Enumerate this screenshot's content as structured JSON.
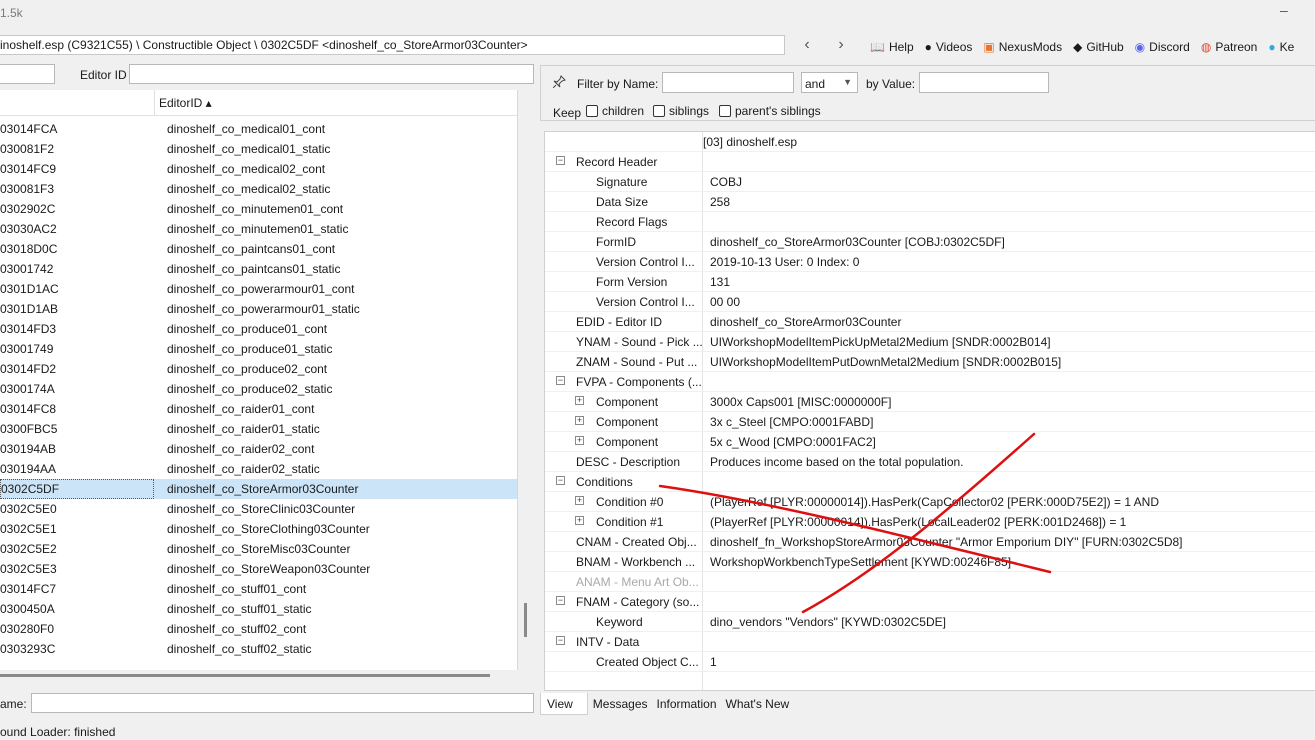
{
  "window": {
    "title": "1.5k",
    "minimize": "–"
  },
  "path": "inoshelf.esp (C9321C55) \\ Constructible Object \\ 0302C5DF <dinoshelf_co_StoreArmor03Counter>",
  "nav": {
    "back": "‹",
    "forward": "›"
  },
  "links": [
    {
      "icon": "📖",
      "label": "Help"
    },
    {
      "icon": "●",
      "label": "Videos"
    },
    {
      "icon": "▣",
      "label": "NexusMods"
    },
    {
      "icon": "◆",
      "label": "GitHub"
    },
    {
      "icon": "◉",
      "label": "Discord"
    },
    {
      "icon": "◍",
      "label": "Patreon"
    },
    {
      "icon": "●",
      "label": "Ke"
    }
  ],
  "left": {
    "editor_id_label": "Editor ID",
    "column_header": "EditorID ▴",
    "rows": [
      {
        "formid": "03014FCA",
        "edid": "dinoshelf_co_medical01_cont"
      },
      {
        "formid": "030081F2",
        "edid": "dinoshelf_co_medical01_static"
      },
      {
        "formid": "03014FC9",
        "edid": "dinoshelf_co_medical02_cont"
      },
      {
        "formid": "030081F3",
        "edid": "dinoshelf_co_medical02_static"
      },
      {
        "formid": "0302902C",
        "edid": "dinoshelf_co_minutemen01_cont"
      },
      {
        "formid": "03030AC2",
        "edid": "dinoshelf_co_minutemen01_static"
      },
      {
        "formid": "03018D0C",
        "edid": "dinoshelf_co_paintcans01_cont"
      },
      {
        "formid": "03001742",
        "edid": "dinoshelf_co_paintcans01_static"
      },
      {
        "formid": "0301D1AC",
        "edid": "dinoshelf_co_powerarmour01_cont"
      },
      {
        "formid": "0301D1AB",
        "edid": "dinoshelf_co_powerarmour01_static"
      },
      {
        "formid": "03014FD3",
        "edid": "dinoshelf_co_produce01_cont"
      },
      {
        "formid": "03001749",
        "edid": "dinoshelf_co_produce01_static"
      },
      {
        "formid": "03014FD2",
        "edid": "dinoshelf_co_produce02_cont"
      },
      {
        "formid": "0300174A",
        "edid": "dinoshelf_co_produce02_static"
      },
      {
        "formid": "03014FC8",
        "edid": "dinoshelf_co_raider01_cont"
      },
      {
        "formid": "0300FBC5",
        "edid": "dinoshelf_co_raider01_static"
      },
      {
        "formid": "030194AB",
        "edid": "dinoshelf_co_raider02_cont"
      },
      {
        "formid": "030194AA",
        "edid": "dinoshelf_co_raider02_static"
      },
      {
        "formid": "0302C5DF",
        "edid": "dinoshelf_co_StoreArmor03Counter"
      },
      {
        "formid": "0302C5E0",
        "edid": "dinoshelf_co_StoreClinic03Counter"
      },
      {
        "formid": "0302C5E1",
        "edid": "dinoshelf_co_StoreClothing03Counter"
      },
      {
        "formid": "0302C5E2",
        "edid": "dinoshelf_co_StoreMisc03Counter"
      },
      {
        "formid": "0302C5E3",
        "edid": "dinoshelf_co_StoreWeapon03Counter"
      },
      {
        "formid": "03014FC7",
        "edid": "dinoshelf_co_stuff01_cont"
      },
      {
        "formid": "0300450A",
        "edid": "dinoshelf_co_stuff01_static"
      },
      {
        "formid": "030280F0",
        "edid": "dinoshelf_co_stuff02_cont"
      },
      {
        "formid": "0303293C",
        "edid": "dinoshelf_co_stuff02_static"
      }
    ],
    "selected_row": 18,
    "name_label": "ame:"
  },
  "filter": {
    "by_name_label": "Filter by Name:",
    "op": "and",
    "by_value_label": "by Value:",
    "keep_label": "Keep",
    "children": "children",
    "siblings": "siblings",
    "parents_siblings": "parent's siblings"
  },
  "tree": [
    {
      "key": "",
      "value": "[03] dinoshelf.esp"
    },
    {
      "key": "Record Header",
      "value": ""
    },
    {
      "key": "Signature",
      "value": "COBJ"
    },
    {
      "key": "Data Size",
      "value": "258"
    },
    {
      "key": "Record Flags",
      "value": ""
    },
    {
      "key": "FormID",
      "value": "dinoshelf_co_StoreArmor03Counter [COBJ:0302C5DF]"
    },
    {
      "key": "Version Control I...",
      "value": "2019-10-13 User: 0 Index: 0"
    },
    {
      "key": "Form Version",
      "value": "131"
    },
    {
      "key": "Version Control I...",
      "value": "00 00"
    },
    {
      "key": "EDID - Editor ID",
      "value": "dinoshelf_co_StoreArmor03Counter"
    },
    {
      "key": "YNAM - Sound - Pick ...",
      "value": "UIWorkshopModelItemPickUpMetal2Medium [SNDR:0002B014]"
    },
    {
      "key": "ZNAM - Sound - Put ...",
      "value": "UIWorkshopModelItemPutDownMetal2Medium [SNDR:0002B015]"
    },
    {
      "key": "FVPA - Components (...",
      "value": ""
    },
    {
      "key": "Component",
      "value": "3000x Caps001 [MISC:0000000F]"
    },
    {
      "key": "Component",
      "value": "3x c_Steel [CMPO:0001FABD]"
    },
    {
      "key": "Component",
      "value": "5x c_Wood [CMPO:0001FAC2]"
    },
    {
      "key": "DESC - Description",
      "value": "Produces income based on the total population."
    },
    {
      "key": "Conditions",
      "value": ""
    },
    {
      "key": "Condition #0",
      "value": "(PlayerRef [PLYR:00000014]).HasPerk(CapCollector02 [PERK:000D75E2]) = 1 AND"
    },
    {
      "key": "Condition #1",
      "value": "(PlayerRef [PLYR:00000014]).HasPerk(LocalLeader02 [PERK:001D2468]) = 1"
    },
    {
      "key": "CNAM - Created Obj...",
      "value": "dinoshelf_fn_WorkshopStoreArmor03Counter \"Armor Emporium DIY\" [FURN:0302C5D8]"
    },
    {
      "key": "BNAM - Workbench ...",
      "value": "WorkshopWorkbenchTypeSettlement [KYWD:00246F85]"
    },
    {
      "key": "ANAM - Menu Art Ob...",
      "value": ""
    },
    {
      "key": "FNAM - Category (so...",
      "value": ""
    },
    {
      "key": "Keyword",
      "value": "dino_vendors \"Vendors\" [KYWD:0302C5DE]"
    },
    {
      "key": "INTV - Data",
      "value": ""
    },
    {
      "key": "Created Object C...",
      "value": "1"
    }
  ],
  "tabs": [
    "View",
    "Messages",
    "Information",
    "What's New"
  ],
  "status": "ound Loader: finished"
}
